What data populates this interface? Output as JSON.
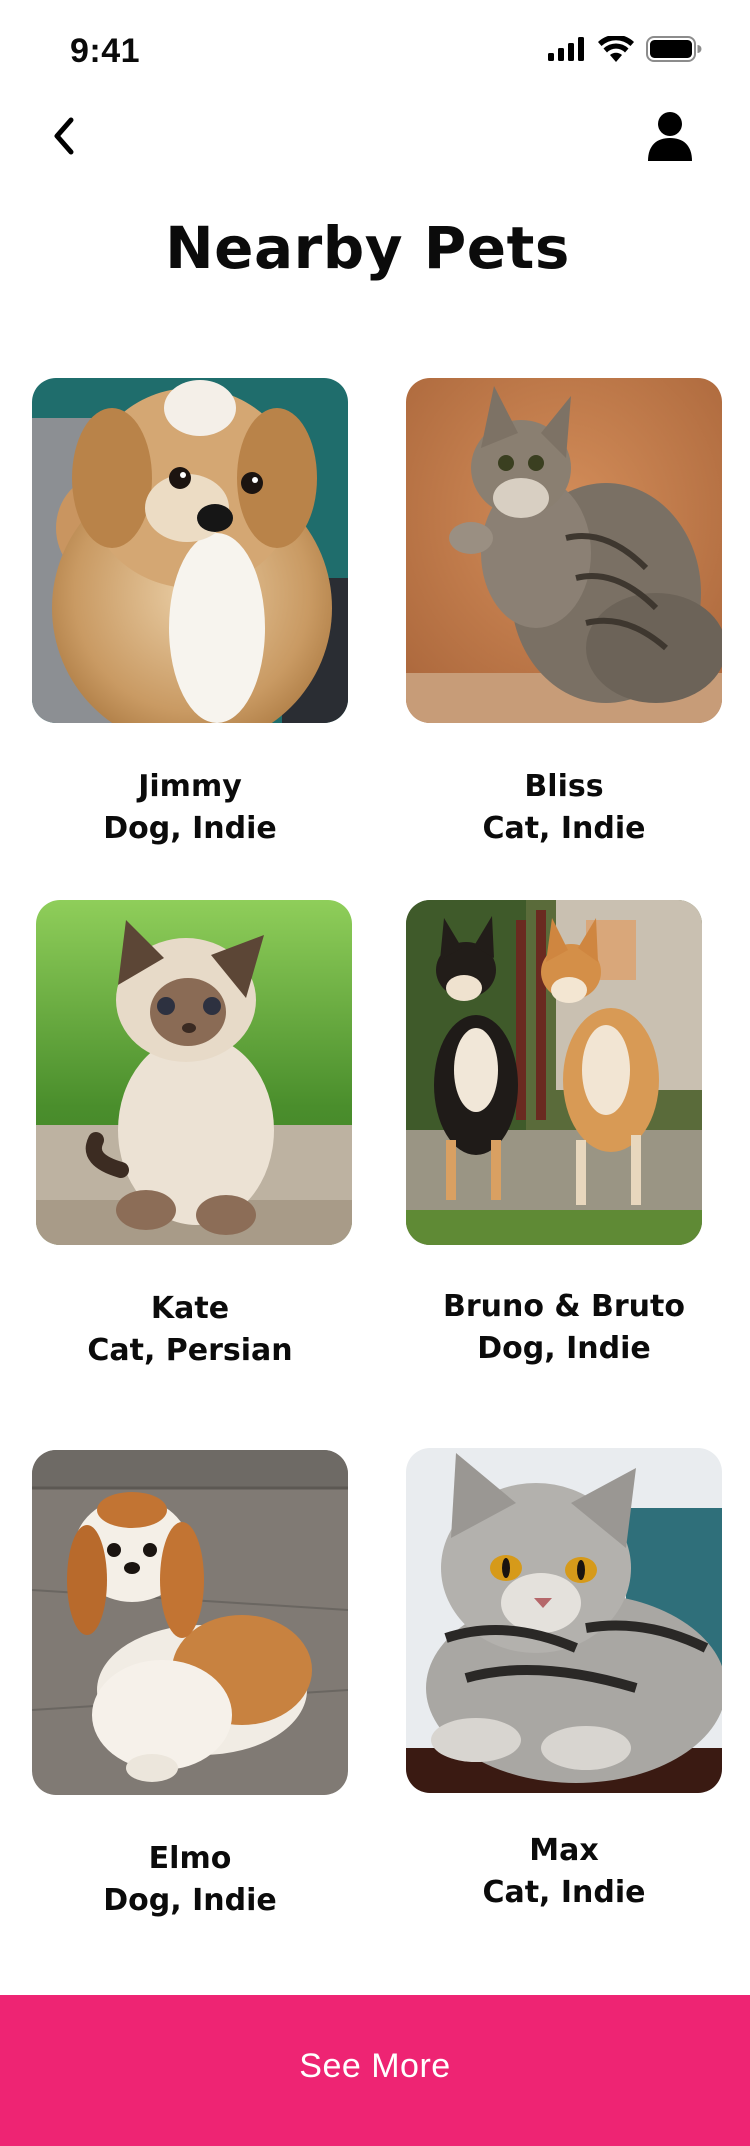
{
  "status_bar": {
    "time": "9:41",
    "icons": [
      "cellular-signal-icon",
      "wifi-icon",
      "battery-icon"
    ]
  },
  "nav": {
    "back_icon": "chevron-left-icon",
    "profile_icon": "user-icon"
  },
  "title": "Nearby Pets",
  "pets": [
    {
      "name": "Jimmy",
      "details": "Dog, Indie",
      "photo": "fluffy tan puppy"
    },
    {
      "name": "Bliss",
      "details": "Cat, Indie",
      "photo": "tabby cat raising paw"
    },
    {
      "name": "Kate",
      "details": "Cat, Persian",
      "photo": "persian kitten on grass"
    },
    {
      "name": "Bruno & Bruto",
      "details": "Dog, Indie",
      "photo": "two shiba inu dogs"
    },
    {
      "name": "Elmo",
      "details": "Dog, Indie",
      "photo": "shih tzu dog"
    },
    {
      "name": "Max",
      "details": "Cat, Indie",
      "photo": "silver tabby cat"
    }
  ],
  "see_more_label": "See More",
  "colors": {
    "accent": "#ee2473",
    "text": "#0b0b0b",
    "background": "#ffffff"
  }
}
